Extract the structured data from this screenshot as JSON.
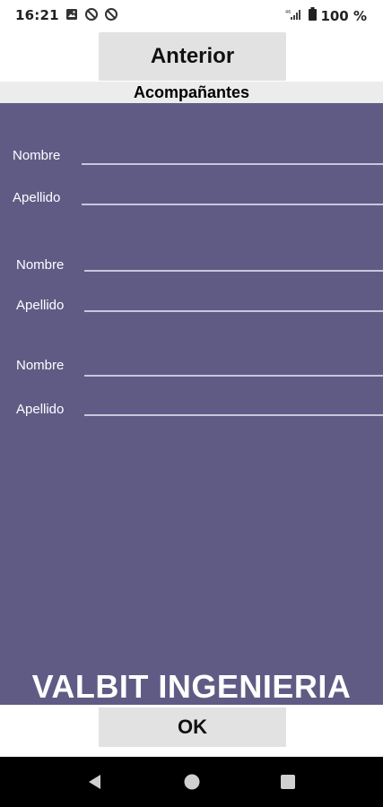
{
  "status_bar": {
    "time": "16:21",
    "battery_text": "100 %",
    "icons_left": [
      "image-icon",
      "sync-off-icon",
      "sync-off-icon"
    ],
    "icons_right": [
      "signal-icon",
      "battery-icon"
    ]
  },
  "top_button": {
    "label": "Anterior"
  },
  "header": {
    "title": "Acompañantes"
  },
  "companions": [
    {
      "first_label": "Nombre",
      "last_label": "Apellido"
    },
    {
      "first_label": "Nombre",
      "last_label": "Apellido"
    },
    {
      "first_label": "Nombre",
      "last_label": "Apellido"
    }
  ],
  "brand": {
    "text": "VALBIT INGENIERIA"
  },
  "ok_button": {
    "label": "OK"
  },
  "nav_bar": {
    "icons": [
      "back-icon",
      "home-icon",
      "recents-icon"
    ]
  },
  "colors": {
    "panel_background": "#605b85",
    "button_background": "#e2e2e2",
    "header_background": "#ececec",
    "field_line": "#c9c6dc"
  }
}
